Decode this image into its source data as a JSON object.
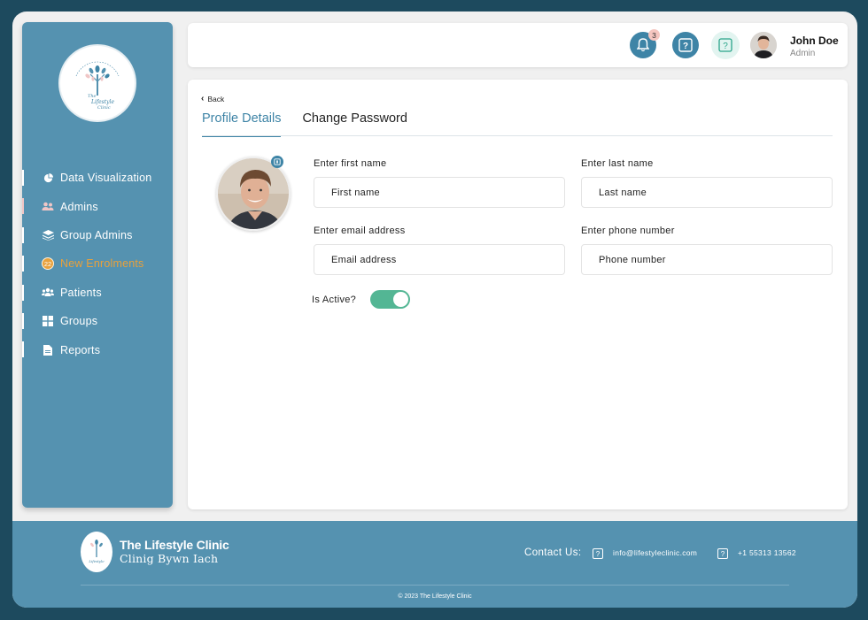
{
  "header": {
    "notification_count": "3",
    "user_name": "John Doe",
    "user_role": "Admin"
  },
  "sidebar": {
    "items": [
      {
        "label": "Data Visualization",
        "icon": "pie-chart-icon"
      },
      {
        "label": "Admins",
        "icon": "users-icon"
      },
      {
        "label": "Group Admins",
        "icon": "layers-icon"
      },
      {
        "label": "New Enrolments",
        "icon": "badge-count",
        "badge": "22",
        "active": true
      },
      {
        "label": "Patients",
        "icon": "group-icon"
      },
      {
        "label": "Groups",
        "icon": "grid-icon"
      },
      {
        "label": "Reports",
        "icon": "document-icon"
      }
    ]
  },
  "main": {
    "back_label": "Back",
    "tabs": [
      {
        "label": "Profile Details",
        "active": true
      },
      {
        "label": "Change Password",
        "active": false
      }
    ],
    "form": {
      "first_name_label": "Enter first name",
      "first_name_placeholder": "First name",
      "last_name_label": "Enter last name",
      "last_name_placeholder": "Last name",
      "email_label": "Enter email address",
      "email_placeholder": "Email address",
      "phone_label": "Enter phone number",
      "phone_placeholder": "Phone number",
      "is_active_label": "Is Active?",
      "is_active": true
    }
  },
  "footer": {
    "title": "The Lifestyle Clinic",
    "subtitle": "Clinig Bywn Iach",
    "contact_label": "Contact Us:",
    "email": "info@lifestyleclinic.com",
    "phone": "+1 55313 13562",
    "copyright": "© 2023 The Lifestyle Clinic"
  },
  "colors": {
    "sidebar_bg": "#5592b0",
    "accent": "#3e84a6",
    "active_orange": "#e8a13c",
    "toggle_green": "#53b694",
    "frame_dark": "#1d4a5e"
  }
}
